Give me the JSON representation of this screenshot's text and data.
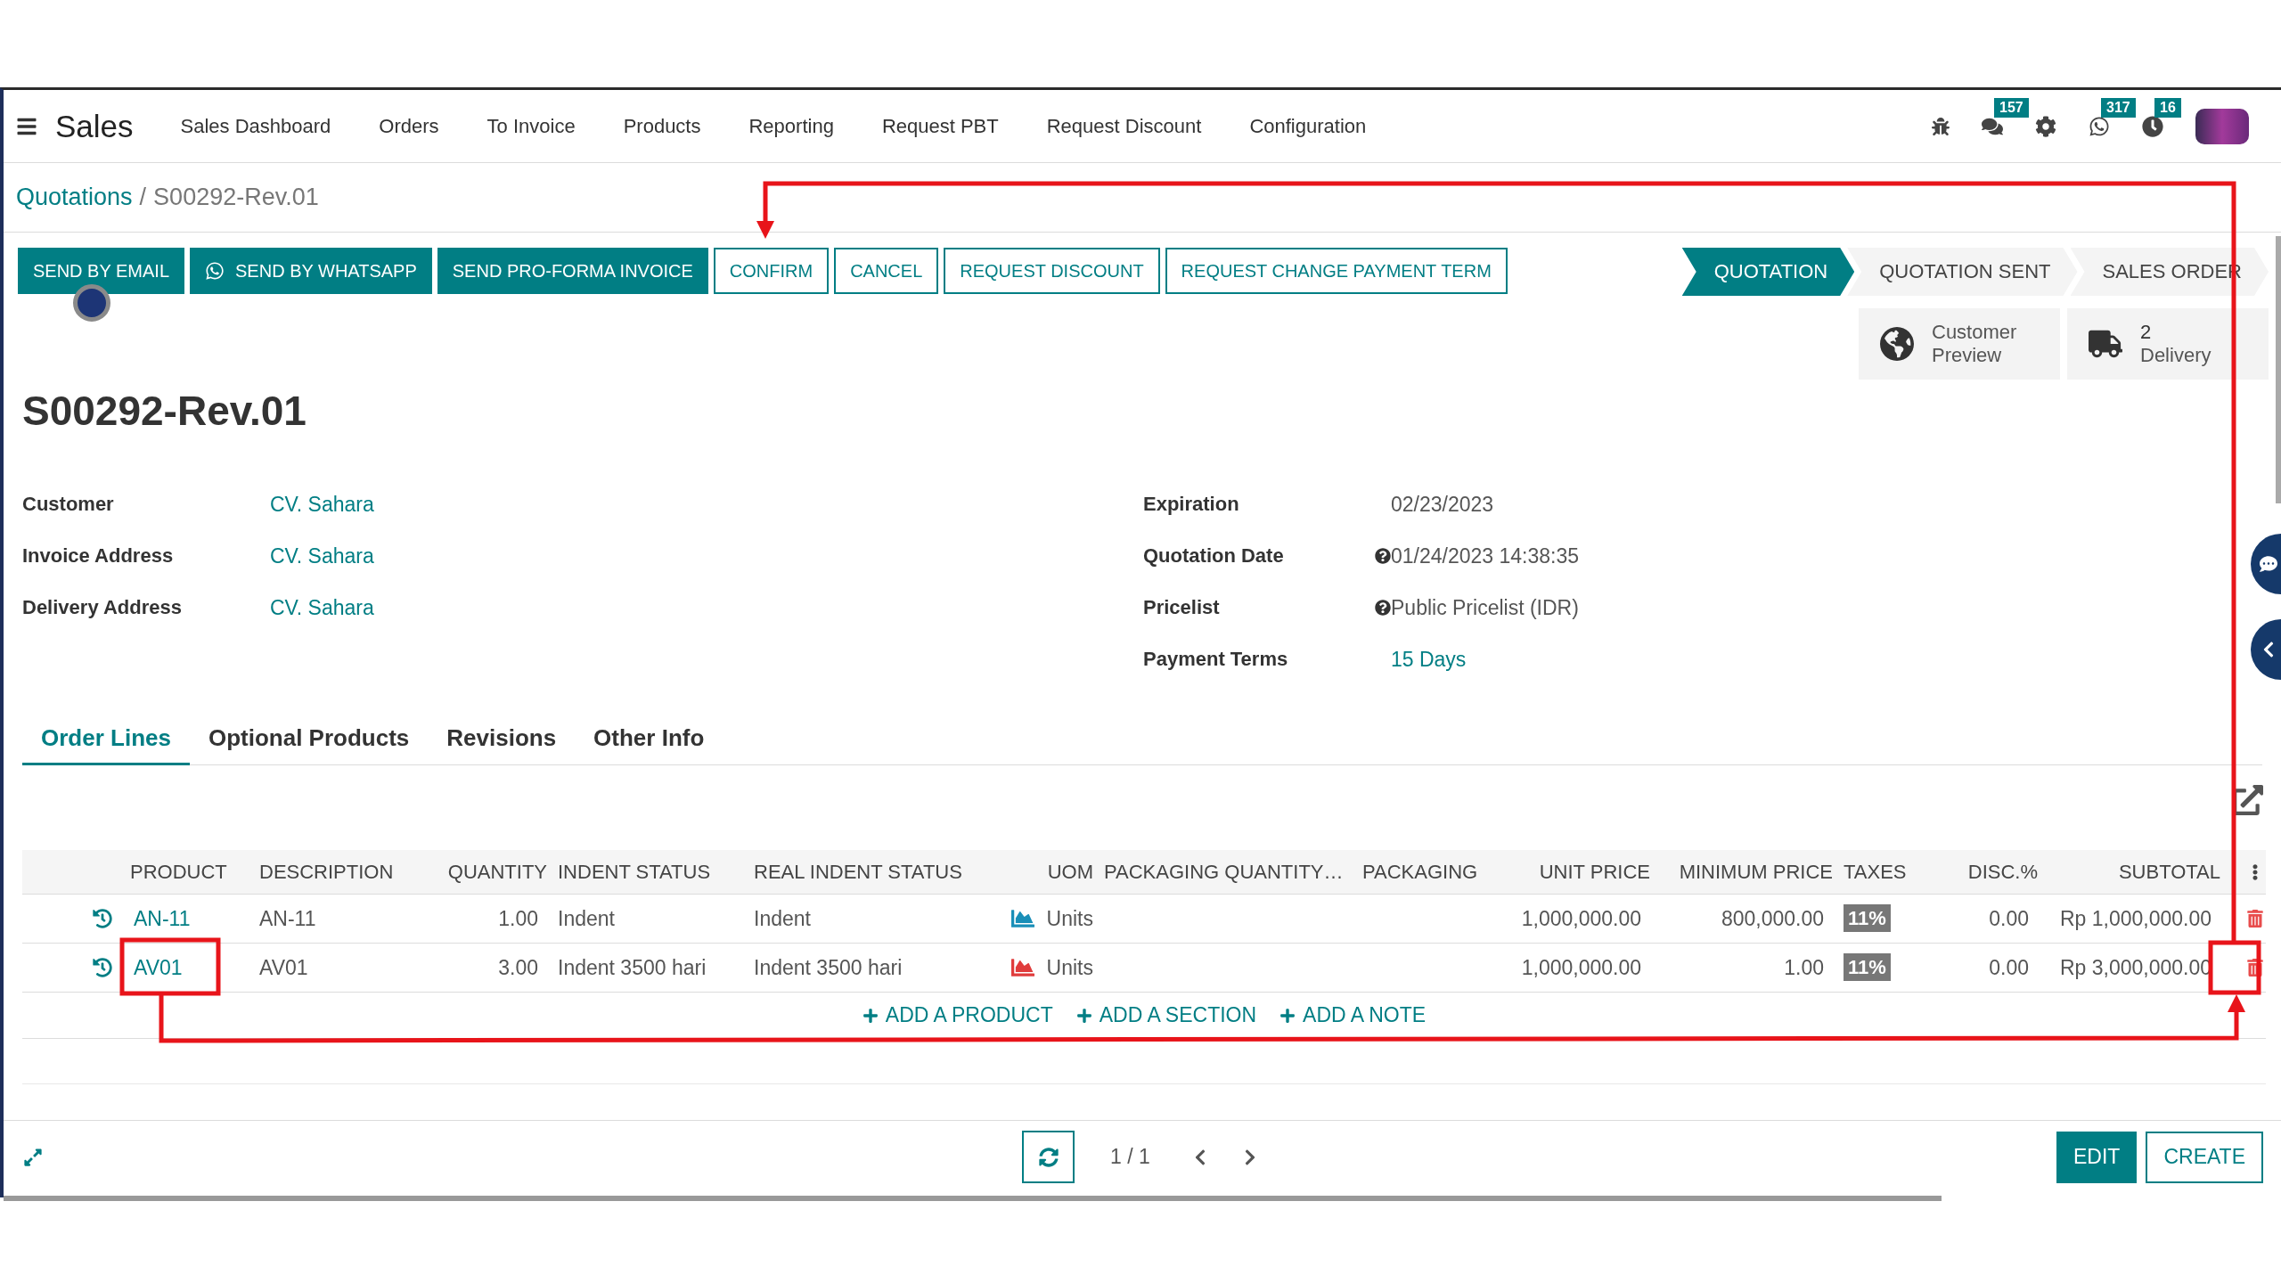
{
  "app": {
    "name": "Sales"
  },
  "nav": [
    "Sales Dashboard",
    "Orders",
    "To Invoice",
    "Products",
    "Reporting",
    "Request PBT",
    "Request Discount",
    "Configuration"
  ],
  "systray": [
    {
      "kind": "bug"
    },
    {
      "kind": "chat",
      "badge": "157"
    },
    {
      "kind": "gear"
    },
    {
      "kind": "whatsapp",
      "badge": "317"
    },
    {
      "kind": "clock",
      "badge": "16"
    },
    {
      "kind": "avatar"
    }
  ],
  "breadcrumb": {
    "parent": "Quotations",
    "separator": "/",
    "current": "S00292-Rev.01"
  },
  "actions": [
    {
      "label": "SEND BY EMAIL",
      "primary": true
    },
    {
      "label": "SEND BY WHATSAPP",
      "primary": true
    },
    {
      "label": "SEND PRO-FORMA INVOICE",
      "primary": true
    },
    {
      "label": "CONFIRM",
      "primary": false
    },
    {
      "label": "CANCEL",
      "primary": false
    },
    {
      "label": "REQUEST DISCOUNT",
      "primary": false
    },
    {
      "label": "REQUEST CHANGE PAYMENT TERM",
      "primary": false
    }
  ],
  "statusbar": [
    {
      "label": "QUOTATION",
      "selected": true
    },
    {
      "label": "QUOTATION SENT",
      "selected": false
    },
    {
      "label": "SALES ORDER",
      "selected": false
    }
  ],
  "smart_buttons": [
    {
      "label": "Customer Preview"
    },
    {
      "value": "2",
      "label": "Delivery"
    }
  ],
  "title": "S00292-Rev.01",
  "fields_left": [
    {
      "label": "Customer",
      "value": "CV. Sahara",
      "link": true,
      "help": false
    },
    {
      "label": "Invoice Address",
      "value": "CV. Sahara",
      "link": true,
      "help": false
    },
    {
      "label": "Delivery Address",
      "value": "CV. Sahara",
      "link": true,
      "help": false
    }
  ],
  "fields_right": [
    {
      "label": "Expiration",
      "value": "02/23/2023",
      "link": false,
      "help": false
    },
    {
      "label": "Quotation Date",
      "value": "01/24/2023 14:38:35",
      "link": false,
      "help": true
    },
    {
      "label": "Pricelist",
      "value": "Public Pricelist (IDR)",
      "link": false,
      "help": true
    },
    {
      "label": "Payment Terms",
      "value": "15 Days",
      "link": true,
      "help": false
    }
  ],
  "tabs": [
    {
      "label": "Order Lines",
      "selected": true
    },
    {
      "label": "Optional Products",
      "selected": false
    },
    {
      "label": "Revisions",
      "selected": false
    },
    {
      "label": "Other Info",
      "selected": false
    }
  ],
  "table": {
    "columns": [
      "PRODUCT",
      "DESCRIPTION",
      "QUANTITY",
      "INDENT STATUS",
      "REAL INDENT STATUS",
      "UOM",
      "PACKAGING QUANTITY…",
      "PACKAGING",
      "UNIT PRICE",
      "MINIMUM PRICE",
      "TAXES",
      "DISC.%",
      "SUBTOTAL"
    ],
    "rows": [
      {
        "product": "AN-11",
        "description": "AN-11",
        "quantity": "1.00",
        "indent_status": "Indent",
        "real_indent_status": "Indent",
        "color": "#1a8fb8",
        "uom": "Units",
        "unit_price": "1,000,000.00",
        "minimum_price": "800,000.00",
        "taxes": "11%",
        "discount": "0.00",
        "subtotal": "Rp 1,000,000.00"
      },
      {
        "product": "AV01",
        "description": "AV01",
        "quantity": "3.00",
        "indent_status": "Indent 3500 hari",
        "real_indent_status": "Indent 3500 hari",
        "color": "#e03c3c",
        "uom": "Units",
        "unit_price": "1,000,000.00",
        "minimum_price": "1.00",
        "taxes": "11%",
        "discount": "0.00",
        "subtotal": "Rp 3,000,000.00"
      }
    ],
    "add_links": [
      "ADD A PRODUCT",
      "ADD A SECTION",
      "ADD A NOTE"
    ]
  },
  "pager": "1 / 1",
  "footer_buttons": [
    {
      "label": "EDIT",
      "primary": true
    },
    {
      "label": "CREATE",
      "primary": false
    }
  ]
}
